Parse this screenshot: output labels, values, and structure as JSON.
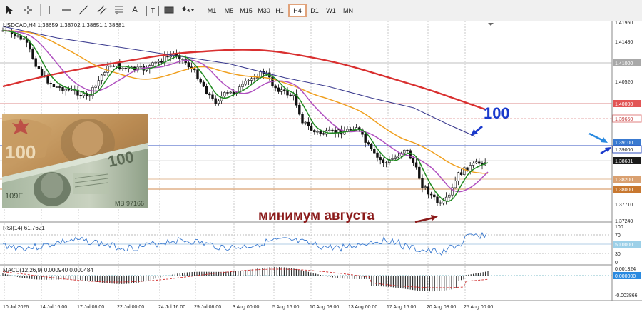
{
  "toolbar": {
    "tools": [
      {
        "name": "cursor-icon"
      },
      {
        "name": "crosshair-icon"
      },
      {
        "name": "vertical-line-icon"
      },
      {
        "name": "horizontal-line-icon"
      },
      {
        "name": "trendline-icon"
      },
      {
        "name": "equidistant-channel-icon"
      },
      {
        "name": "fibonacci-icon"
      },
      {
        "name": "text-icon",
        "label": "A"
      },
      {
        "name": "text-label-icon",
        "label": "T"
      },
      {
        "name": "rectangle-icon"
      },
      {
        "name": "shapes-dropdown-icon"
      }
    ],
    "timeframes": [
      "M1",
      "M5",
      "M15",
      "M30",
      "H1",
      "H4",
      "D1",
      "W1",
      "MN"
    ],
    "active_timeframe": "H4"
  },
  "main_header": "USDCAD,H4  1.38659 1.38702 1.38651 1.38681",
  "annotations": {
    "big_number": "100",
    "minimum_label": "минимум августа"
  },
  "price_axis": {
    "ticks": [
      "1.41950",
      "1.41480",
      "1.41000",
      "1.40520",
      "1.40000",
      "1.39650",
      "1.39100",
      "1.39000",
      "1.38681",
      "1.38200",
      "1.38000",
      "1.37710",
      "1.37240"
    ],
    "labels": {
      "l1": "1.41000",
      "l2": "1.40000",
      "l3": "1.39650",
      "l4": "1.39100",
      "l5": "1.39000",
      "l6": "1.38681",
      "l7": "1.38200",
      "l8": "1.38000"
    }
  },
  "rsi": {
    "header": "RSI(14) 61.7621",
    "ticks": [
      "100",
      "70",
      "50.0000",
      "30",
      "0"
    ]
  },
  "macd": {
    "header": "MACD(12,26,9) 0.000940 0.000484",
    "ticks": [
      "0.001324",
      "0.000000",
      "-0.003866"
    ]
  },
  "time_axis": [
    "10 Jul 2026",
    "14 Jul 16:00",
    "17 Jul 08:00",
    "22 Jul 00:00",
    "24 Jul 16:00",
    "29 Jul 08:00",
    "3 Aug 00:00",
    "5 Aug 16:00",
    "10 Aug 08:00",
    "13 Aug 00:00",
    "17 Aug 16:00",
    "20 Aug 08:00",
    "25 Aug 00:00"
  ],
  "colors": {
    "ema_red": "#d93030",
    "ema_blue": "#3b3b8f",
    "ema_orange": "#f0a020",
    "ema_magenta": "#b050c0",
    "ema_green": "#208a20",
    "annotation_blue": "#1a3acc",
    "annotation_red": "#8b1a1a",
    "arrow_blue": "#2a8ae0"
  }
}
